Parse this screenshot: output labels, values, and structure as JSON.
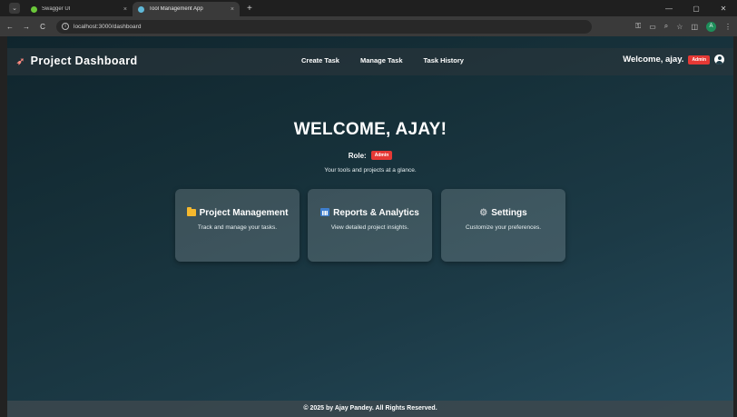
{
  "browser": {
    "tabs": [
      {
        "title": "Swagger UI",
        "favicon_color": "#6bc83a",
        "active": false
      },
      {
        "title": "Tool Management App",
        "favicon_color": "#5fb8d8",
        "active": true
      }
    ],
    "tab_close": "×",
    "new_tab": "+",
    "url": "localhost:3000/dashboard",
    "back": "←",
    "forward": "→",
    "reload": "C",
    "profile_initial": "A",
    "window_minimize": "—",
    "window_restore": "▢",
    "window_close": "✕"
  },
  "navbar": {
    "brand": "Project Dashboard",
    "links": [
      "Create Task",
      "Manage Task",
      "Task History"
    ],
    "welcome": "Welcome, ajay.",
    "role_badge": "Admin"
  },
  "hero": {
    "title": "WELCOME, AJAY!",
    "role_label": "Role:",
    "role_badge": "Admin",
    "tagline": "Your tools and projects at a glance."
  },
  "cards": [
    {
      "title": "Project Management",
      "description": "Track and manage your tasks.",
      "icon": "folder-icon"
    },
    {
      "title": "Reports & Analytics",
      "description": "View detailed project insights.",
      "icon": "bar-chart-icon"
    },
    {
      "title": "Settings",
      "description": "Customize your preferences.",
      "icon": "gear-icon"
    }
  ],
  "footer": {
    "text": "© 2025 by Ajay Pandey. All Rights Reserved."
  },
  "colors": {
    "badge": "#e53935",
    "page_gradient_start": "#10252d",
    "page_gradient_end": "#254b5c"
  }
}
